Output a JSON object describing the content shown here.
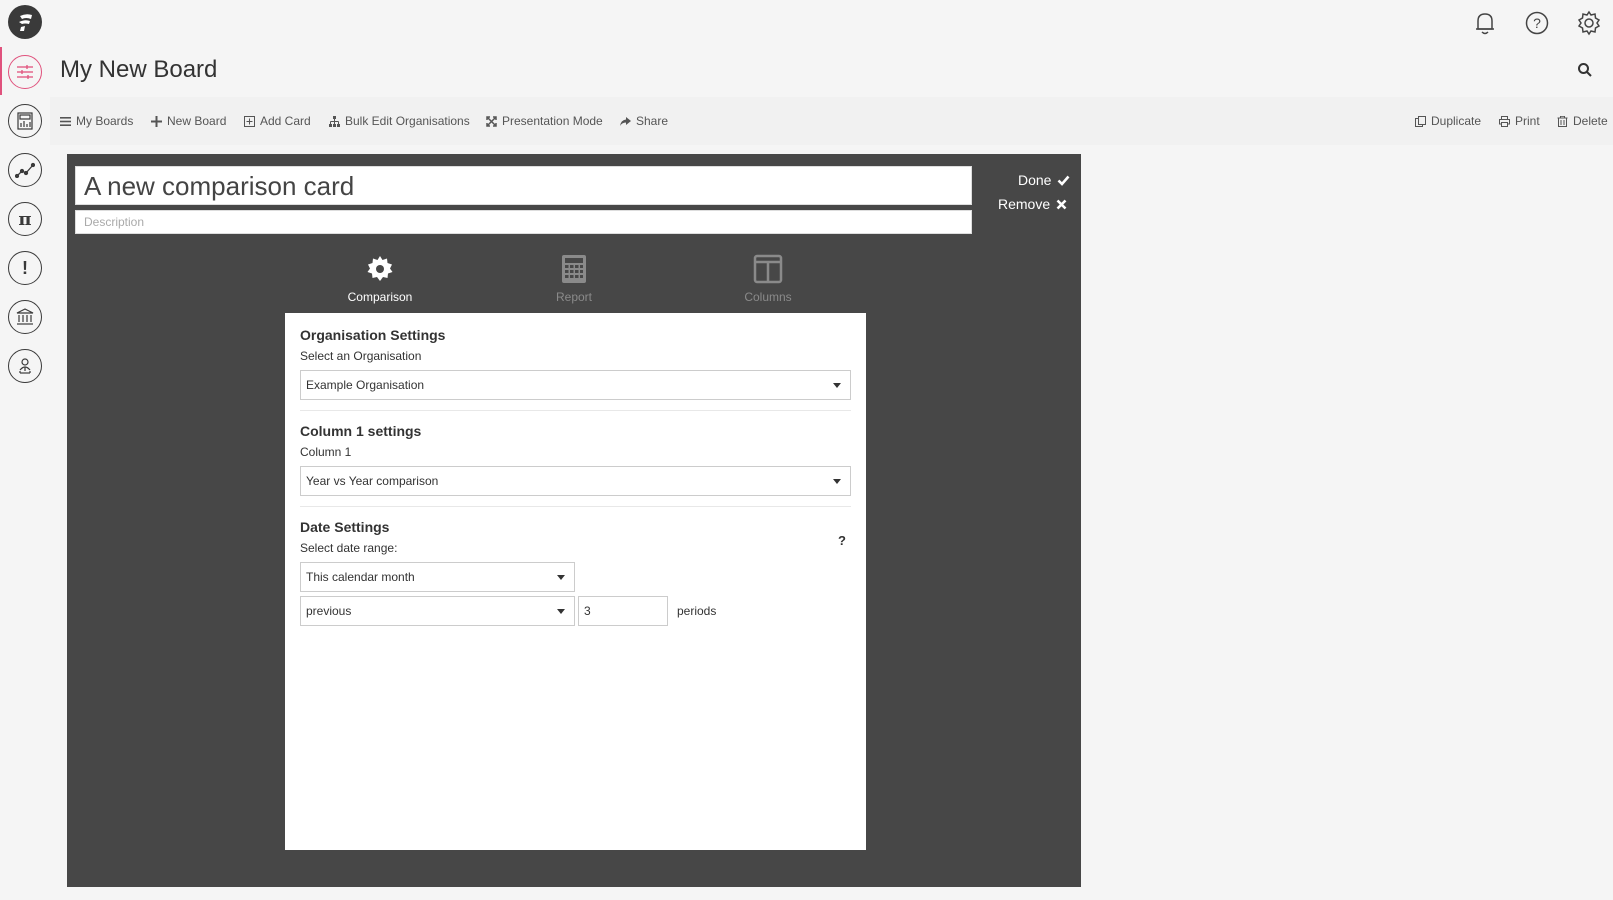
{
  "app": {
    "logo_icon": "fathom-logo-icon"
  },
  "header": {
    "title": "My New Board"
  },
  "sidebar": {
    "items": [
      {
        "name": "settings-sliders-icon",
        "active": true
      },
      {
        "name": "pdf-report-icon",
        "active": false
      },
      {
        "name": "trend-chart-icon",
        "active": false
      },
      {
        "name": "pi-icon",
        "active": false
      },
      {
        "name": "alert-icon",
        "active": false
      },
      {
        "name": "bank-icon",
        "active": false
      },
      {
        "name": "user-tree-icon",
        "active": false
      }
    ]
  },
  "toolbar": {
    "my_boards": "My Boards",
    "new_board": "New Board",
    "add_card": "Add Card",
    "bulk_edit": "Bulk Edit Organisations",
    "presentation": "Presentation Mode",
    "share": "Share",
    "duplicate": "Duplicate",
    "print": "Print",
    "delete": "Delete"
  },
  "card": {
    "title": "A new comparison card",
    "description_placeholder": "Description",
    "done_label": "Done",
    "remove_label": "Remove"
  },
  "tabs": [
    {
      "label": "Comparison",
      "icon": "gear-icon"
    },
    {
      "label": "Report",
      "icon": "calculator-icon"
    },
    {
      "label": "Columns",
      "icon": "columns-icon"
    }
  ],
  "settings": {
    "org": {
      "title": "Organisation Settings",
      "label": "Select an Organisation",
      "value": "Example Organisation"
    },
    "column1": {
      "title": "Column 1 settings",
      "label": "Column 1",
      "value": "Year vs Year comparison"
    },
    "date": {
      "title": "Date Settings",
      "label": "Select date range:",
      "help": "?",
      "range_value": "This calendar month",
      "direction_value": "previous",
      "periods_value": "3",
      "periods_label": "periods"
    }
  },
  "colors": {
    "accent": "#e0527d",
    "panel": "#474747"
  }
}
